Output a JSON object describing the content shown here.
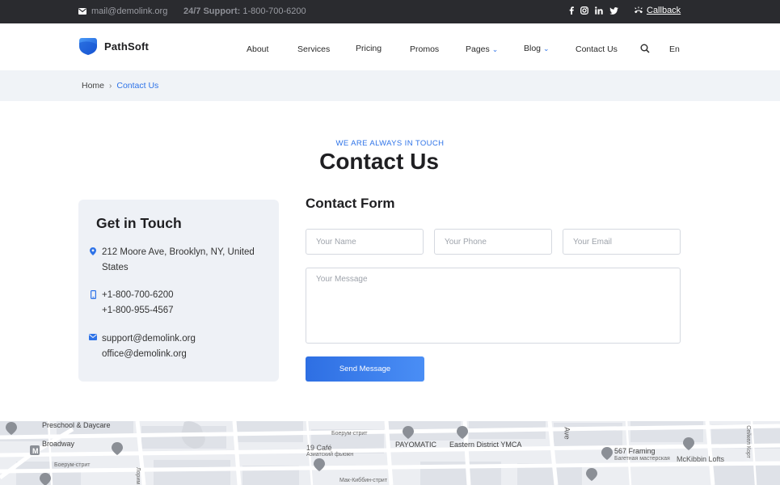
{
  "topbar": {
    "email": "mail@demolink.org",
    "support_label": "24/7 Support:",
    "support_phone": "1-800-700-6200",
    "socials": [
      "f",
      "ig",
      "in",
      "tw"
    ],
    "callback": "Callback"
  },
  "header": {
    "brand": "PathSoft",
    "nav": [
      "About",
      "Services",
      "Pricing",
      "Promos",
      "Pages",
      "Blog",
      "Contact Us"
    ],
    "lang": "En"
  },
  "breadcrumb": {
    "home": "Home",
    "current": "Contact Us"
  },
  "hero": {
    "eyebrow": "WE ARE ALWAYS IN TOUCH",
    "title": "Contact Us"
  },
  "info": {
    "title": "Get in Touch",
    "address": [
      "212 Moore Ave, Brooklyn, NY, United",
      "States"
    ],
    "phones": [
      "+1-800-700-6200",
      "+1-800-955-4567"
    ],
    "emails": [
      "support@demolink.org",
      "office@demolink.org"
    ]
  },
  "form": {
    "title": "Contact Form",
    "name_placeholder": "Your Name",
    "phone_placeholder": "Your Phone",
    "email_placeholder": "Your Email",
    "message_placeholder": "Your Message",
    "submit": "Send Message"
  },
  "map": {
    "labels": [
      "Preschool & Daycare",
      "Broadway",
      "19 Café",
      "PAYOMATIC",
      "Eastern District YMCA",
      "567 Framing",
      "McKibbin Lofts",
      "Ave"
    ],
    "small_labels": [
      "Боерум-стрит",
      "Азиатский фьюжн",
      "Боерум-стрит",
      "Мак-Киббин-стрит",
      "Багетная мастерская",
      "Сейкел Корт",
      "Лорим"
    ]
  },
  "colors": {
    "accent": "#2e73e8",
    "topbar": "#2a2b2f",
    "light_bg": "#f0f3f7"
  }
}
